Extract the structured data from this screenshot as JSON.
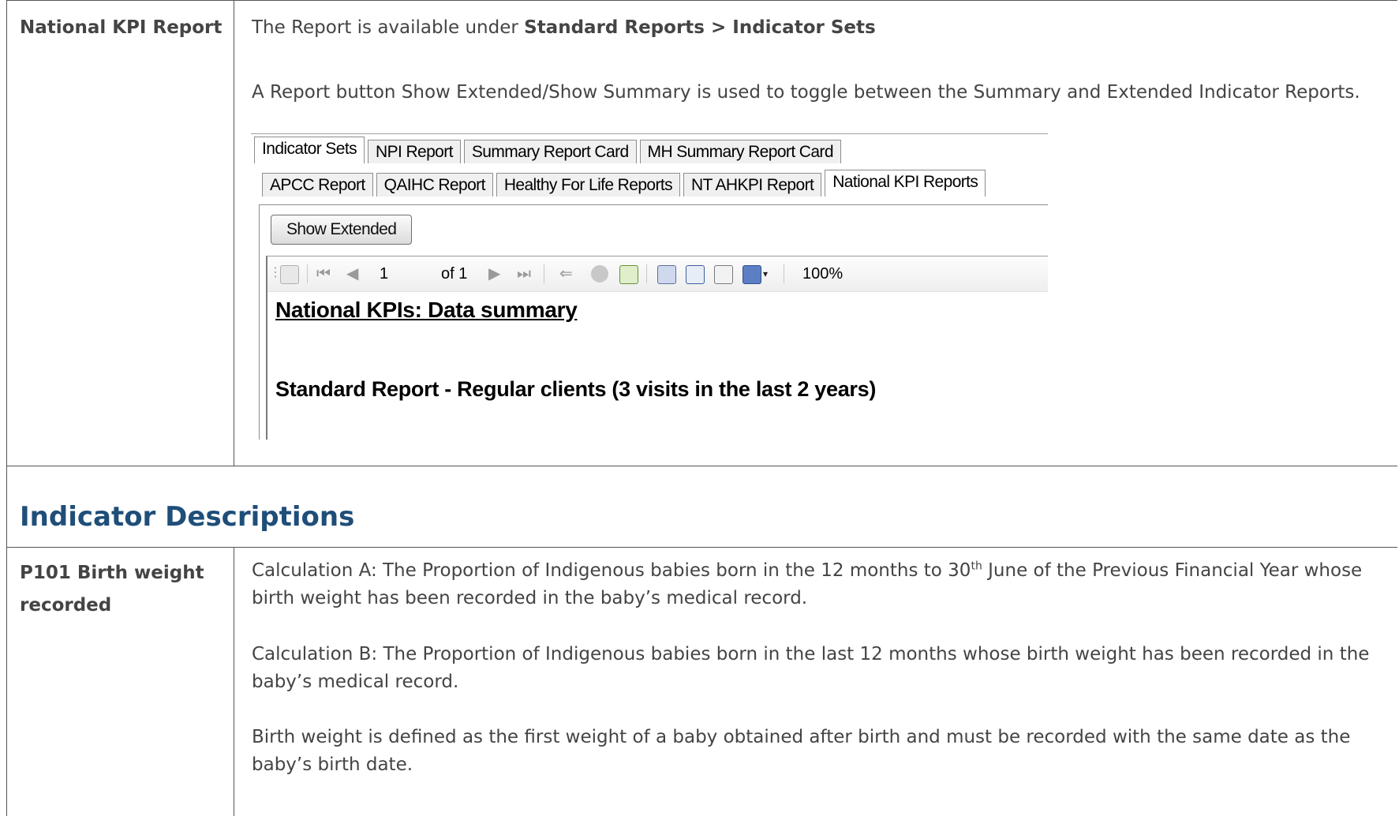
{
  "row1": {
    "label": "National KPI Report",
    "intro_text": "The Report is available under ",
    "intro_path": "Standard Reports > Indicator Sets",
    "toggle_text": "A Report button Show Extended/Show Summary is used to toggle between the Summary and Extended Indicator Reports."
  },
  "screenshot": {
    "tabs_row1": [
      "Indicator Sets",
      "NPI Report",
      "Summary Report Card",
      "MH Summary Report Card"
    ],
    "tabs_row2": [
      "APCC Report",
      "QAIHC Report",
      "Healthy For Life Reports",
      "NT AHKPI Report",
      "National KPI Reports"
    ],
    "active_tab_row1": "Indicator Sets",
    "active_tab_row2": "National KPI Reports",
    "button_label": "Show Extended",
    "toolbar": {
      "page_current": "1",
      "page_of": "of 1",
      "zoom": "100%"
    },
    "report_title": "National KPIs: Data summary",
    "report_subtitle": "Standard Report - Regular clients (3 visits in the last 2 years)"
  },
  "section": {
    "heading": "Indicator Descriptions"
  },
  "row2": {
    "label": "P101 Birth weight recorded",
    "calc_a_before": "Calculation A: The Proportion of Indigenous babies born in the 12 months to 30",
    "calc_a_sup": "th",
    "calc_a_after": " June of the Previous Financial Year whose birth weight has been recorded in the baby’s medical record.",
    "calc_b": "Calculation B: The Proportion of Indigenous babies born in the last 12 months whose birth weight has been recorded in the baby’s medical record.",
    "definition": "Birth weight is defined as the first weight of a baby obtained after birth and must be recorded with the same date as the baby’s birth date."
  }
}
